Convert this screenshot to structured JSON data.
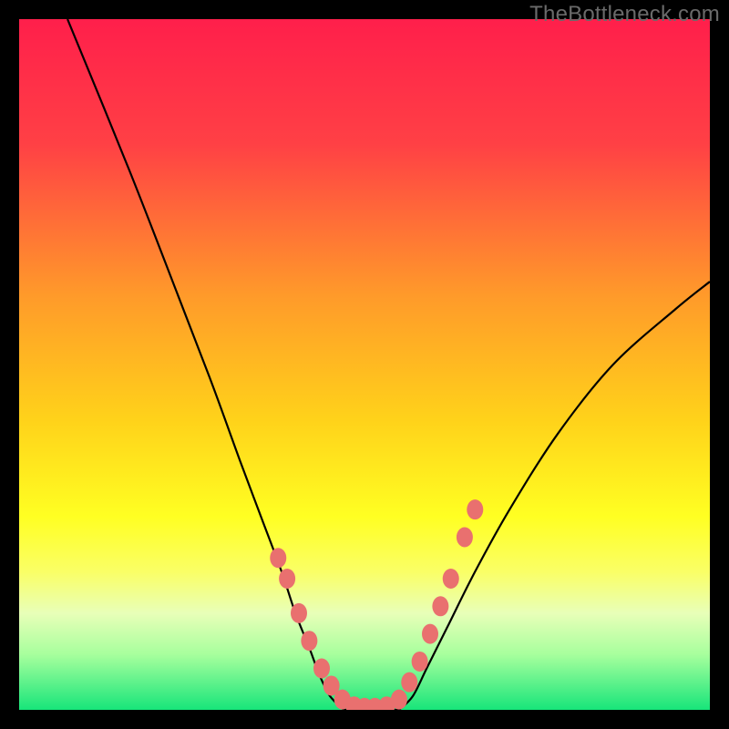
{
  "watermark": "TheBottleneck.com",
  "chart_data": {
    "type": "line",
    "title": "",
    "xlabel": "",
    "ylabel": "",
    "xlim": [
      0,
      100
    ],
    "ylim": [
      0,
      100
    ],
    "background_gradient_stops": [
      {
        "offset": 0,
        "color": "#ff1f4b"
      },
      {
        "offset": 18,
        "color": "#ff4045"
      },
      {
        "offset": 40,
        "color": "#ff9a2a"
      },
      {
        "offset": 58,
        "color": "#ffd21a"
      },
      {
        "offset": 72,
        "color": "#ffff22"
      },
      {
        "offset": 80,
        "color": "#faff66"
      },
      {
        "offset": 86,
        "color": "#e8ffb8"
      },
      {
        "offset": 92,
        "color": "#a7ff9d"
      },
      {
        "offset": 100,
        "color": "#17e57a"
      }
    ],
    "series": [
      {
        "name": "curve-left",
        "x": [
          7,
          16,
          23,
          28,
          32,
          35,
          38,
          40,
          42,
          43.5,
          45,
          47
        ],
        "values": [
          100,
          78,
          60,
          47,
          36,
          28,
          20,
          14,
          9,
          5,
          2,
          0
        ]
      },
      {
        "name": "valley-floor",
        "x": [
          47,
          49,
          51,
          53,
          55
        ],
        "values": [
          0,
          0,
          0,
          0,
          0
        ]
      },
      {
        "name": "curve-right",
        "x": [
          55,
          57,
          59,
          62,
          66,
          71,
          78,
          86,
          95,
          100
        ],
        "values": [
          0,
          2,
          6,
          12,
          20,
          29,
          40,
          50,
          58,
          62
        ]
      }
    ],
    "markers": [
      {
        "x": 37.5,
        "y": 22
      },
      {
        "x": 38.8,
        "y": 19
      },
      {
        "x": 40.5,
        "y": 14
      },
      {
        "x": 42.0,
        "y": 10
      },
      {
        "x": 43.8,
        "y": 6
      },
      {
        "x": 45.2,
        "y": 3.5
      },
      {
        "x": 46.8,
        "y": 1.5
      },
      {
        "x": 48.5,
        "y": 0.5
      },
      {
        "x": 50.0,
        "y": 0.3
      },
      {
        "x": 51.5,
        "y": 0.3
      },
      {
        "x": 53.2,
        "y": 0.5
      },
      {
        "x": 55.0,
        "y": 1.5
      },
      {
        "x": 56.5,
        "y": 4
      },
      {
        "x": 58.0,
        "y": 7
      },
      {
        "x": 59.5,
        "y": 11
      },
      {
        "x": 61.0,
        "y": 15
      },
      {
        "x": 62.5,
        "y": 19
      },
      {
        "x": 64.5,
        "y": 25
      },
      {
        "x": 66.0,
        "y": 29
      }
    ],
    "marker_color": "#e9706f",
    "curve_color": "#000000"
  }
}
